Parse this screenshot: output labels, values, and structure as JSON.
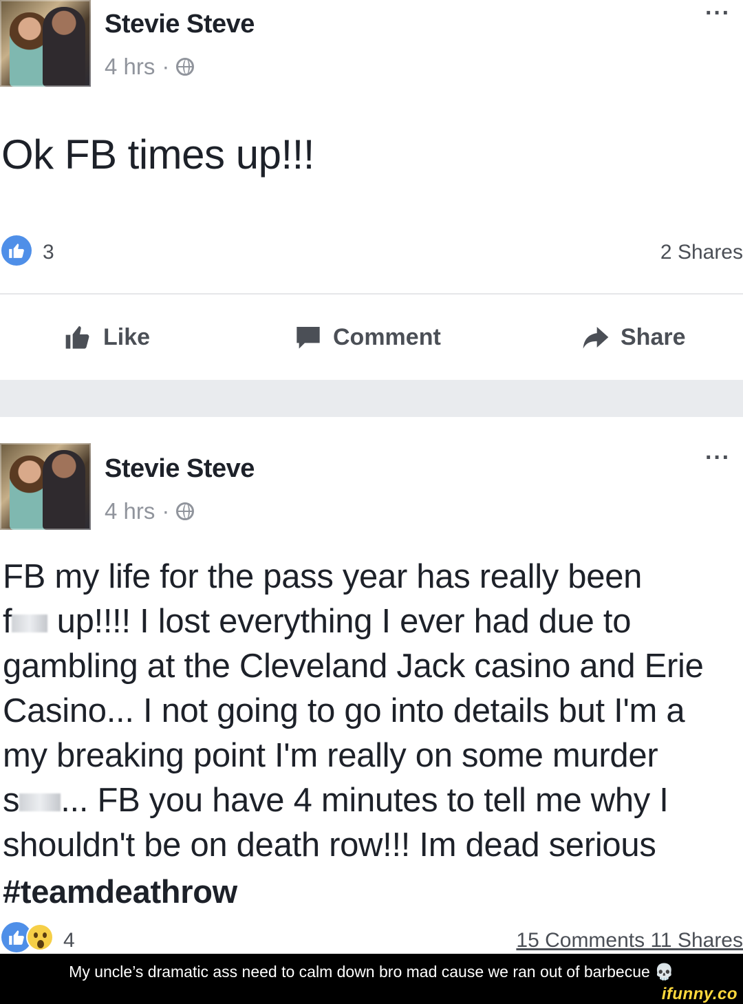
{
  "posts": [
    {
      "author": "Stevie Steve",
      "timestamp": "4 hrs",
      "separator": "·",
      "privacy_icon": "globe-icon",
      "more_label": "···",
      "status_text": "Ok FB times up!!!",
      "reactions": {
        "types": [
          "like"
        ],
        "count": "3"
      },
      "shares": "2 Shares",
      "actions": [
        {
          "label": "Like",
          "icon": "thumbs-up-icon"
        },
        {
          "label": "Comment",
          "icon": "comment-icon"
        },
        {
          "label": "Share",
          "icon": "share-arrow-icon"
        }
      ]
    },
    {
      "author": "Stevie Steve",
      "timestamp": "4 hrs",
      "separator": "·",
      "privacy_icon": "globe-icon",
      "more_label": "···",
      "body_lines": [
        "FB my life for the pass year has really been",
        "up!!!! I lost everything I ever had due to",
        "gambling at the Cleveland Jack casino and Erie",
        "Casino... I not going to go into details but I'm a",
        "my breaking point I'm really on some murder",
        "... FB you have 4 minutes to tell me why I",
        "shouldn't be on death row!!! Im dead serious"
      ],
      "body_censored_prefix_1": "f",
      "body_censored_prefix_2": "s",
      "hashtag": "#teamdeathrow",
      "reactions": {
        "types": [
          "like",
          "wow"
        ],
        "count": "4"
      },
      "comments_shares": "15 Comments 11 Shares"
    }
  ],
  "caption": "My uncle’s dramatic ass need to calm down bro mad cause we ran out of barbecue 💀",
  "watermark": "ifunny.co",
  "colors": {
    "like_blue": "#4f8fe8",
    "text_dark": "#1d2129",
    "text_gray": "#90949c",
    "feed_bg": "#e9ebee"
  }
}
